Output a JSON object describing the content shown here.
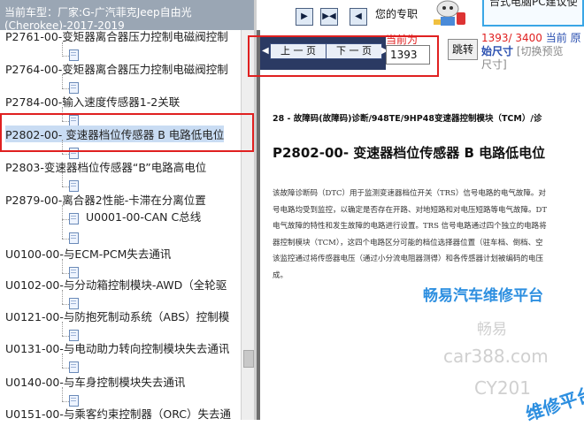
{
  "left_panel": {
    "vehicle_label": "当前车型：",
    "vehicle_value": "厂家:G-广汽菲克Jeep自由光(Cherokee)-2017-2019",
    "tree_items": [
      {
        "label": "P2761-00-变矩器离合器压力控制电磁阀控制"
      },
      {
        "label": "P2764-00-变矩器离合器压力控制电磁阀控制"
      },
      {
        "label": "P2784-00-输入速度传感器1-2关联"
      },
      {
        "label": "P2802-00- 变速器档位传感器 B 电路低电位"
      },
      {
        "label": "P2803-变速器档位传感器“B”电路高电位"
      },
      {
        "label": "P2879-00-离合器2性能-卡滞在分离位置"
      },
      {
        "label": "U0001-00-CAN C总线"
      },
      {
        "label": "U0100-00-与ECM-PCM失去通讯"
      },
      {
        "label": "U0102-00-与分动箱控制模块-AWD（全轮驱"
      },
      {
        "label": "U0121-00-与防抱死制动系统（ABS）控制模"
      },
      {
        "label": "U0131-00-与电动助力转向控制模块失去通讯"
      },
      {
        "label": "U0140-00-与车身控制模块失去通讯"
      },
      {
        "label": "U0151-00-与乘客约束控制器（ORC）失去通"
      }
    ]
  },
  "toolbar": {
    "help_text": "您的专职",
    "promo_text": "台式电脑PC建议使"
  },
  "pager": {
    "prev_label": "上 一 页",
    "next_label": "下 一 页",
    "current_label": "当前为",
    "page_value": "1393",
    "jump_label": "跳转",
    "page_count": "1393/ 3400",
    "current_original": "当前 原",
    "size_label": "始尺寸",
    "switch_label": "[切换预览",
    "size_suffix": "尺寸]"
  },
  "document": {
    "header": "28 - 故障码(故障码)诊断/948TE/9HP48变速器控制模块（TCM）/诊",
    "title": "P2802-00- 变速器档位传感器  B  电路低电位",
    "body": [
      "该故障诊断码（DTC）用于监测变速器档位开关（TRS）信号电路的电气故障。对",
      "号电路均受到监控，以确定是否存在开路、对地短路和对电压短路等电气故障。DT",
      "电气故障的特性和发生故障的电路进行设置。TRS 信号电路通过四个独立的电路将",
      "器控制模块（TCM），这四个电路区分可能的档位选择器位置（驻车档、倒档、空",
      "该监控通过将传感器电压（通过小分流电阻器测得）和各传感器计划被编码的电压",
      "成。"
    ]
  },
  "watermarks": {
    "line1": "畅易汽车维修平台",
    "line2": "畅易",
    "line3": "car388.com",
    "line4": "CY201",
    "line5": "维修平台"
  },
  "colors": {
    "red_highlight": "#e02020",
    "pager_dark": "#2b3a63",
    "header_gray": "#9aa6b4",
    "watermark_blue": "#2d8fe0"
  }
}
